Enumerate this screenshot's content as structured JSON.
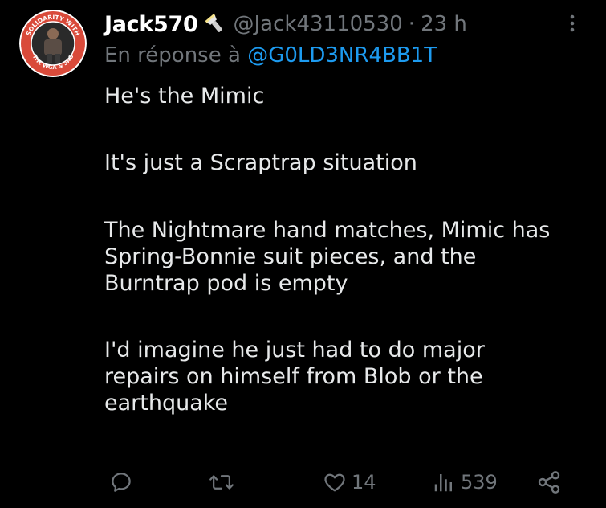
{
  "tweet": {
    "display_name": "Jack570",
    "badge_icon": "flashlight-icon",
    "handle": "@Jack43110530",
    "separator": "·",
    "time": "23 h",
    "reply_prefix": "En réponse à",
    "reply_to": "@G0LD3NR4BB1T",
    "paragraphs": [
      [
        "He's the Mimic"
      ],
      [
        "It's just a Scraptrap situation"
      ],
      [
        "The Nightmare hand matches, Mimic has",
        "Spring-Bonnie suit pieces, and the",
        "Burntrap pod is empty"
      ],
      [
        "I'd imagine he just had to do major",
        "repairs on himself from Blob or the",
        "earthquake"
      ]
    ],
    "avatar_text_top": "SOLIDARITY WITH",
    "avatar_text_bottom": "THE WGA & SAG"
  },
  "actions": {
    "reply": {
      "icon": "reply-icon",
      "count": ""
    },
    "retweet": {
      "icon": "retweet-icon",
      "count": ""
    },
    "like": {
      "icon": "heart-icon",
      "count": "14"
    },
    "views": {
      "icon": "views-icon",
      "count": "539"
    },
    "share": {
      "icon": "share-icon"
    }
  },
  "colors": {
    "background": "#000000",
    "text": "#e7e9ea",
    "secondary": "#71767b",
    "link": "#1d9bf0",
    "avatar_ring": "#d94a3a"
  }
}
